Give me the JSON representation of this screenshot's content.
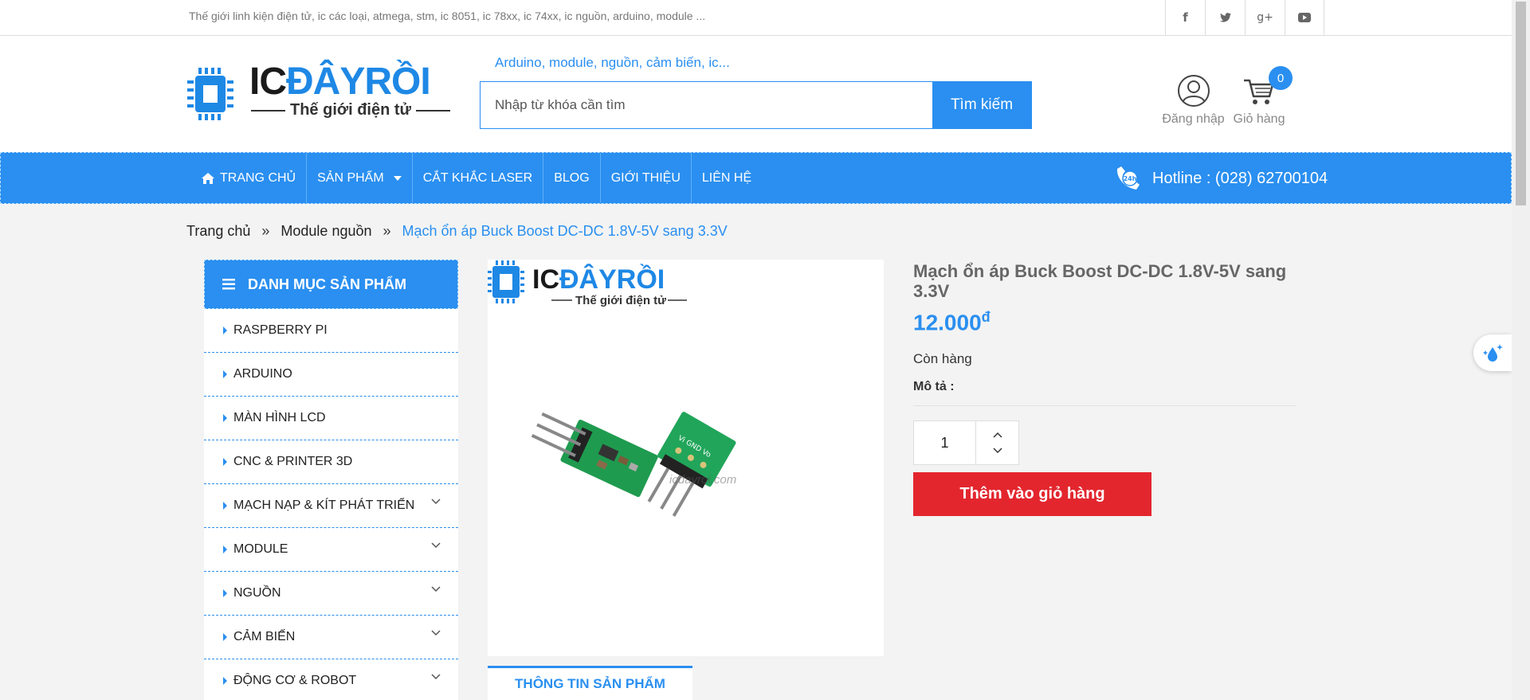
{
  "topbar": {
    "slogan": "Thế giới linh kiện điện tử, ic các loại, atmega, stm, ic 8051, ic 78xx, ic 74xx, ic nguồn, arduino, module ...",
    "social": [
      "facebook-icon",
      "twitter-icon",
      "google-plus-icon",
      "youtube-icon"
    ]
  },
  "header": {
    "logo_brand_left": "IC",
    "logo_brand_right": "ĐÂYRỒI",
    "logo_tagline": "Thế giới điện tử",
    "search_hint": "Arduino, module, nguồn, cảm biến, ic...",
    "search_placeholder": "Nhập từ khóa cần tìm",
    "search_button": "Tìm kiếm",
    "login_label": "Đăng nhập",
    "cart_label": "Giỏ hàng",
    "cart_count": "0"
  },
  "nav": {
    "items": [
      "TRANG CHỦ",
      "SẢN PHẨM",
      "CẮT KHẮC LASER",
      "BLOG",
      "GIỚI THIỆU",
      "LIÊN HỆ"
    ],
    "hotline": "Hotline : (028) 62700104"
  },
  "breadcrumb": {
    "home": "Trang chủ",
    "category": "Module nguồn",
    "current": "Mạch ổn áp Buck Boost DC-DC 1.8V-5V sang 3.3V"
  },
  "sidebar": {
    "title": "DANH MỤC SẢN PHẨM",
    "items": [
      {
        "label": "RASPBERRY PI",
        "has_sub": false
      },
      {
        "label": "ARDUINO",
        "has_sub": false
      },
      {
        "label": "MÀN HÌNH LCD",
        "has_sub": false
      },
      {
        "label": "CNC & PRINTER 3D",
        "has_sub": false
      },
      {
        "label": "MẠCH NẠP & KÍT PHÁT TRIỂN",
        "has_sub": true
      },
      {
        "label": "MODULE",
        "has_sub": true
      },
      {
        "label": "NGUỒN",
        "has_sub": true
      },
      {
        "label": "CẢM BIẾN",
        "has_sub": true
      },
      {
        "label": "ĐỘNG CƠ & ROBOT",
        "has_sub": true
      }
    ]
  },
  "product": {
    "title": "Mạch ổn áp Buck Boost DC-DC 1.8V-5V sang 3.3V",
    "price": "12.000",
    "currency": "đ",
    "stock": "Còn hàng",
    "desc_label": "Mô tả :",
    "quantity": "1",
    "add_to_cart": "Thêm vào giỏ hàng",
    "image_watermark": "icdayroi.com",
    "tab_info": "THÔNG TIN SẢN PHẨM"
  },
  "colors": {
    "accent": "#2a8ff0",
    "cta": "#e3262e"
  }
}
